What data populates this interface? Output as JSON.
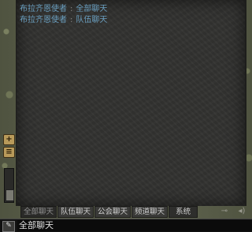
{
  "chat": {
    "messages": [
      {
        "sender": "布拉齐恩使者",
        "channel": "全部聊天"
      },
      {
        "sender": "布拉齐恩使者",
        "channel": "队伍聊天"
      }
    ]
  },
  "tabs": [
    {
      "label": "全部聊天",
      "active": true
    },
    {
      "label": "队伍聊天",
      "active": false
    },
    {
      "label": "公会聊天",
      "active": false
    },
    {
      "label": "频道聊天",
      "active": false
    },
    {
      "label": "系统",
      "active": false
    }
  ],
  "sidebar": {
    "add_icon": "add-icon",
    "menu_icon": "menu-icon"
  },
  "input": {
    "value": "全部聊天",
    "icon": "chat-mode-icon"
  },
  "tool_icons": [
    "key-icon",
    "volume-icon"
  ],
  "colors": {
    "message_text": "#6a9fc0",
    "panel_bg": "#323230",
    "tab_text": "#cfcfcf",
    "button_gold": "#b89a5a"
  }
}
